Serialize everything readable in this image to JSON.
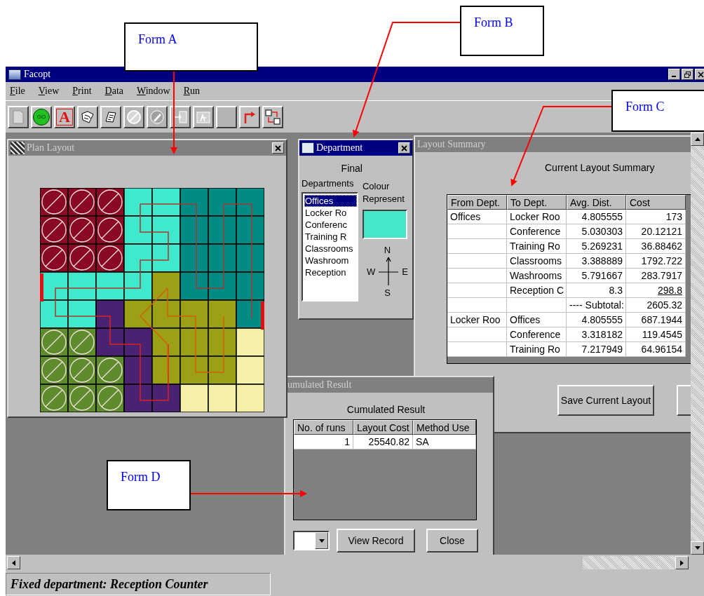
{
  "callouts": [
    {
      "label": "Form A"
    },
    {
      "label": "Form B"
    },
    {
      "label": "Form C"
    },
    {
      "label": "Form D"
    }
  ],
  "window": {
    "title": "Facopt"
  },
  "menu": [
    {
      "label": "File"
    },
    {
      "label": "View"
    },
    {
      "label": "Print"
    },
    {
      "label": "Data"
    },
    {
      "label": "Window"
    },
    {
      "label": "Run"
    }
  ],
  "toolbar": [
    {
      "kind": "new",
      "disabled": true
    },
    {
      "kind": "go",
      "label": "GO",
      "disabled": false
    },
    {
      "kind": "text",
      "label": "A",
      "disabled": false
    },
    {
      "kind": "map",
      "disabled": false
    },
    {
      "kind": "book",
      "disabled": false
    },
    {
      "kind": "forbid",
      "disabled": true
    },
    {
      "kind": "edit",
      "disabled": true
    },
    {
      "kind": "step",
      "disabled": true
    },
    {
      "kind": "chart",
      "disabled": true
    },
    {
      "kind": "blank",
      "disabled": true
    },
    {
      "kind": "route",
      "disabled": false
    },
    {
      "kind": "swap",
      "disabled": false
    }
  ],
  "plan_layout": {
    "title": "Plan Layout",
    "active": false
  },
  "department": {
    "title": "Department",
    "active": true,
    "final_label": "Final",
    "list_label": "Departments",
    "colour_label": "Colour Represent",
    "items": [
      {
        "label": "Offices",
        "selected": true
      },
      {
        "label": "Locker Ro",
        "selected": false
      },
      {
        "label": "Conferenc",
        "selected": false
      },
      {
        "label": "Training R",
        "selected": false
      },
      {
        "label": "Classrooms",
        "selected": false
      },
      {
        "label": "Washroom",
        "selected": false
      },
      {
        "label": "Reception",
        "selected": false
      }
    ],
    "compass": {
      "north": "N",
      "west": "W",
      "east": "E",
      "south": "S"
    }
  },
  "layout_summary": {
    "title": "Layout Summary",
    "active": false,
    "heading": "Current Layout Summary",
    "columns": [
      "From Dept.",
      "To Dept.",
      "Avg. Dist.",
      "Cost"
    ],
    "rows": [
      {
        "cells": [
          "Offices",
          "Locker Roo",
          "4.805555",
          "173"
        ],
        "underline": false
      },
      {
        "cells": [
          "",
          "Conference",
          "5.030303",
          "20.12121"
        ],
        "underline": false
      },
      {
        "cells": [
          "",
          "Training Ro",
          "5.269231",
          "36.88462"
        ],
        "underline": false
      },
      {
        "cells": [
          "",
          "Classrooms",
          "3.388889",
          "1792.722"
        ],
        "underline": false
      },
      {
        "cells": [
          "",
          "Washrooms",
          "5.791667",
          "283.7917"
        ],
        "underline": false
      },
      {
        "cells": [
          "",
          "Reception C",
          "8.3",
          "298.8"
        ],
        "underline": true
      },
      {
        "cells": [
          "",
          "",
          "---- Subtotal:",
          "2605.32"
        ],
        "underline": false
      },
      {
        "cells": [
          "Locker Roo",
          "Offices",
          "4.805555",
          "687.1944"
        ],
        "underline": false
      },
      {
        "cells": [
          "",
          "Conference",
          "3.318182",
          "119.4545"
        ],
        "underline": false
      },
      {
        "cells": [
          "",
          "Training Ro",
          "7.217949",
          "64.96154"
        ],
        "underline": false
      }
    ],
    "buttons": [
      "Save Current Layout"
    ]
  },
  "cumulated": {
    "title": "umulated Result",
    "active": false,
    "heading": "Cumulated Result",
    "columns": [
      "No. of runs",
      "Layout Cost",
      "Method Use"
    ],
    "rows": [
      [
        "1",
        "25540.82",
        "SA"
      ]
    ],
    "buttons": [
      "View Record",
      "Close"
    ]
  },
  "status_bar": {
    "text": "Fixed department: Reception Counter"
  }
}
